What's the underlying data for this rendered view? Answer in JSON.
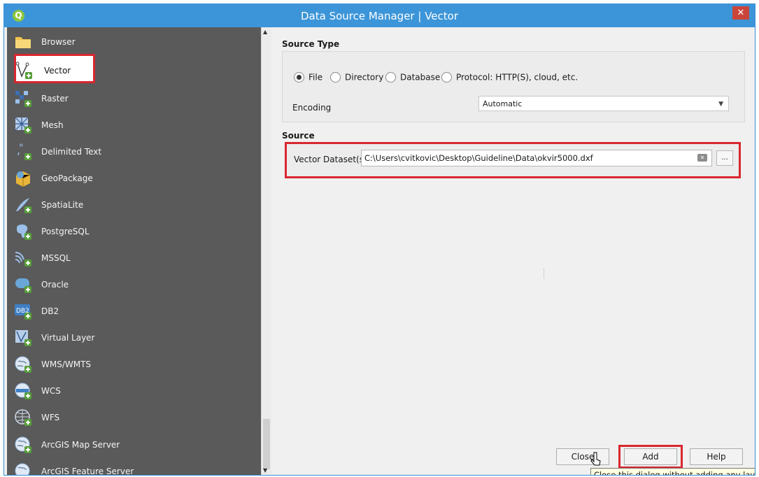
{
  "window": {
    "title": "Data Source Manager | Vector",
    "app_icon_letter": "Q",
    "close_glyph": "✕"
  },
  "sidebar": {
    "items": [
      {
        "label": "Browser",
        "icon": "folder-icon"
      },
      {
        "label": "Vector",
        "icon": "vector-icon"
      },
      {
        "label": "Raster",
        "icon": "raster-icon"
      },
      {
        "label": "Mesh",
        "icon": "mesh-icon"
      },
      {
        "label": "Delimited Text",
        "icon": "delimited-text-icon"
      },
      {
        "label": "GeoPackage",
        "icon": "geopackage-icon"
      },
      {
        "label": "SpatiaLite",
        "icon": "spatialite-icon"
      },
      {
        "label": "PostgreSQL",
        "icon": "postgresql-icon"
      },
      {
        "label": "MSSQL",
        "icon": "mssql-icon"
      },
      {
        "label": "Oracle",
        "icon": "oracle-icon"
      },
      {
        "label": "DB2",
        "icon": "db2-icon"
      },
      {
        "label": "Virtual Layer",
        "icon": "virtual-layer-icon"
      },
      {
        "label": "WMS/WMTS",
        "icon": "wms-icon"
      },
      {
        "label": "WCS",
        "icon": "wcs-icon"
      },
      {
        "label": "WFS",
        "icon": "wfs-icon"
      },
      {
        "label": "ArcGIS Map Server",
        "icon": "arcgis-map-icon"
      },
      {
        "label": "ArcGIS Feature Server",
        "icon": "arcgis-feature-icon"
      }
    ],
    "selected": "Vector",
    "db2_icon_text": "DB2"
  },
  "source_type": {
    "title": "Source Type",
    "options": [
      "File",
      "Directory",
      "Database",
      "Protocol: HTTP(S), cloud, etc."
    ],
    "selected": "File",
    "encoding_label": "Encoding",
    "encoding_value": "Automatic"
  },
  "source": {
    "title": "Source",
    "dataset_label": "Vector Dataset(s)",
    "dataset_value": "C:\\Users\\cvitkovic\\Desktop\\Guideline\\Data\\okvir5000.dxf",
    "browse_label": "..."
  },
  "buttons": {
    "close": "Close",
    "add": "Add",
    "help": "Help"
  },
  "tooltip": "Close this dialog without adding any layer",
  "colors": {
    "titlebar": "#3c95d8",
    "sidebar": "#5a5a5a",
    "highlight": "#d9262f",
    "close": "#c9453a"
  }
}
